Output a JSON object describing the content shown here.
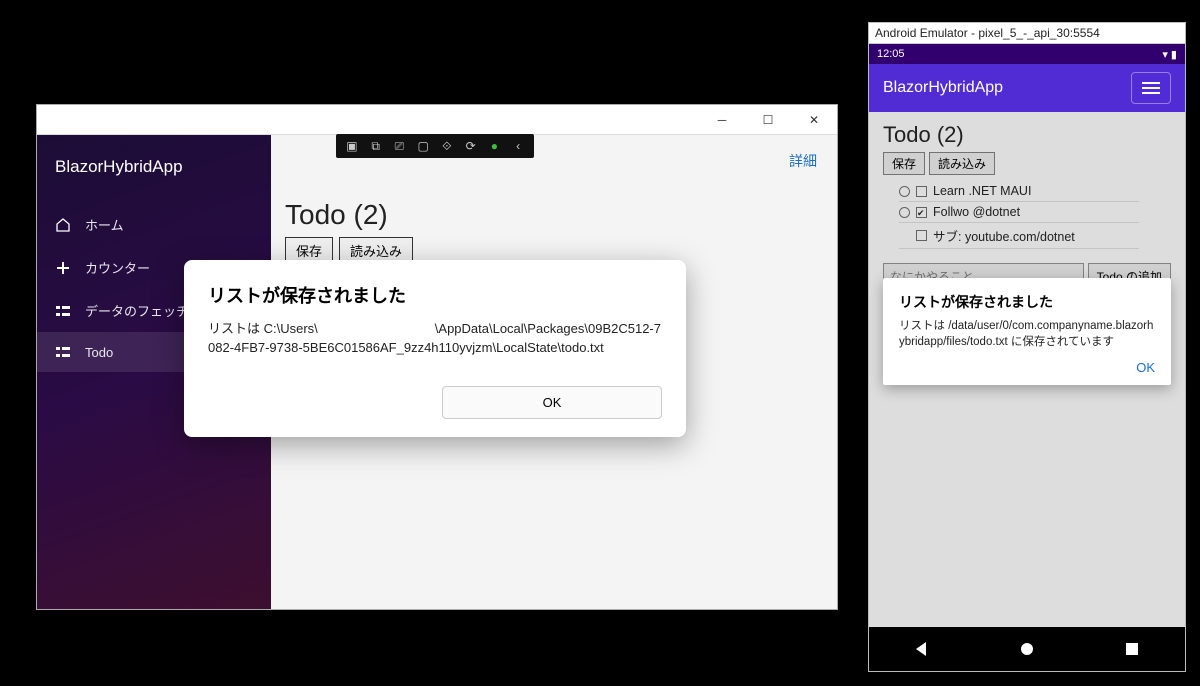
{
  "windows": {
    "brand": "BlazorHybridApp",
    "nav": {
      "home": "ホーム",
      "counter": "カウンター",
      "fetch": "データのフェッチ",
      "todo": "Todo"
    },
    "detail_link": "詳細",
    "todo_title": "Todo (2)",
    "save_btn": "保存",
    "load_btn": "読み込み",
    "dialog": {
      "title": "リストが保存されました",
      "body": "リストは C:\\Users\\　　　　　　　　　\\AppData\\Local\\Packages\\09B2C512-7082-4FB7-9738-5BE6C01586AF_9zz4h110yvjzm\\LocalState\\todo.txt",
      "ok": "OK"
    }
  },
  "android": {
    "emulator_title": "Android Emulator - pixel_5_-_api_30:5554",
    "clock": "12:05",
    "brand": "BlazorHybridApp",
    "todo_title": "Todo (2)",
    "save_btn": "保存",
    "load_btn": "読み込み",
    "items": {
      "i0": "Learn .NET MAUI",
      "i1": "Follwo @dotnet",
      "i2": "サブ: youtube.com/dotnet"
    },
    "input_placeholder": "なにかやること",
    "add_btn": "Todo の追加",
    "dialog": {
      "title": "リストが保存されました",
      "body": "リストは /data/user/0/com.companyname.blazorhybridapp/files/todo.txt に保存されています",
      "ok": "OK"
    }
  }
}
